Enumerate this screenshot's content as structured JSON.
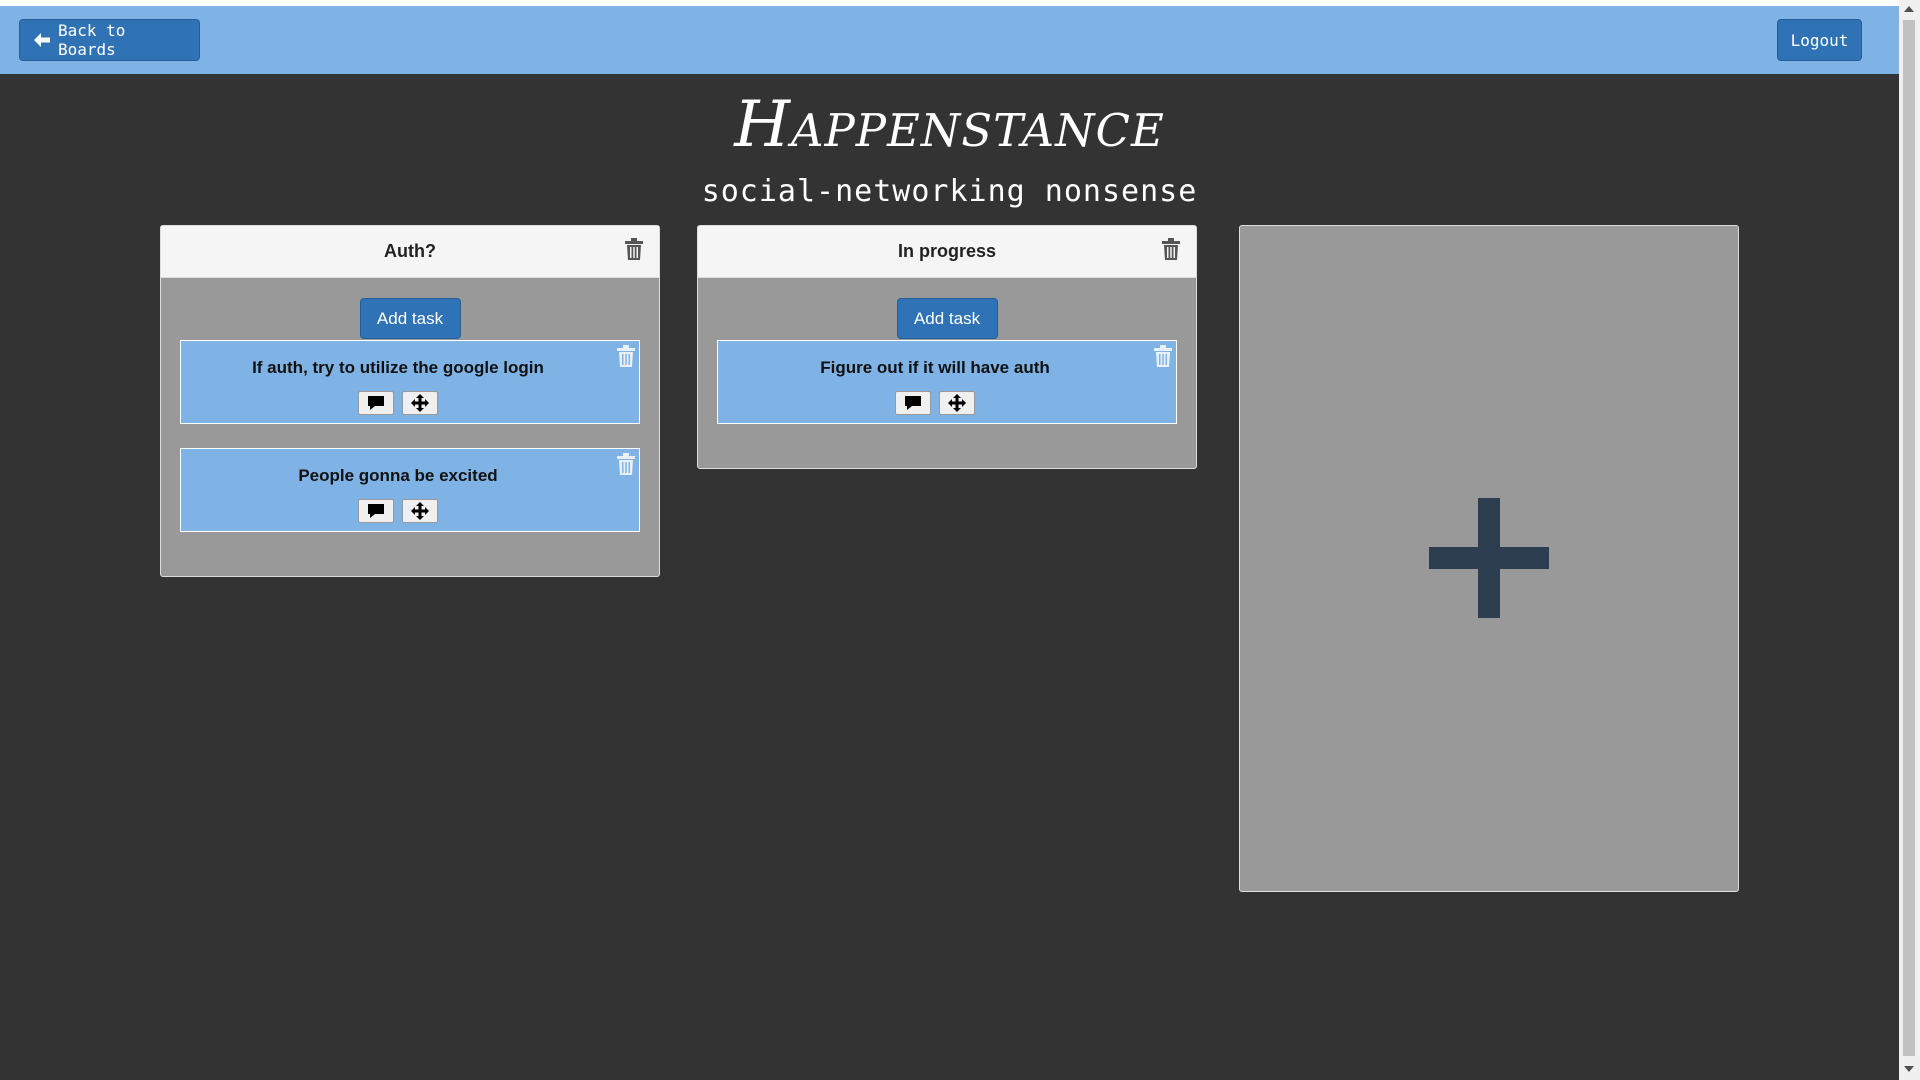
{
  "navbar": {
    "back_label": "Back to Boards",
    "logout_label": "Logout"
  },
  "header": {
    "title": "Happenstance",
    "subtitle": "social-networking nonsense"
  },
  "lists": [
    {
      "title": "Auth?",
      "add_task_label": "Add task",
      "tasks": [
        {
          "title": "If auth, try to utilize the google login"
        },
        {
          "title": "People gonna be excited"
        }
      ]
    },
    {
      "title": "In progress",
      "add_task_label": "Add task",
      "tasks": [
        {
          "title": "Figure out if it will have auth"
        }
      ]
    }
  ],
  "icons": {
    "back": "arrow-left-icon",
    "trash": "trash-icon",
    "comment": "comment-icon",
    "move": "move-icon",
    "add_list": "plus-icon"
  },
  "colors": {
    "background": "#333333",
    "navbar": "#7fb2e5",
    "primary_button": "#2f72b5",
    "list_body": "#999999",
    "task_card": "#7fb2e5",
    "plus": "#2c3e50"
  }
}
